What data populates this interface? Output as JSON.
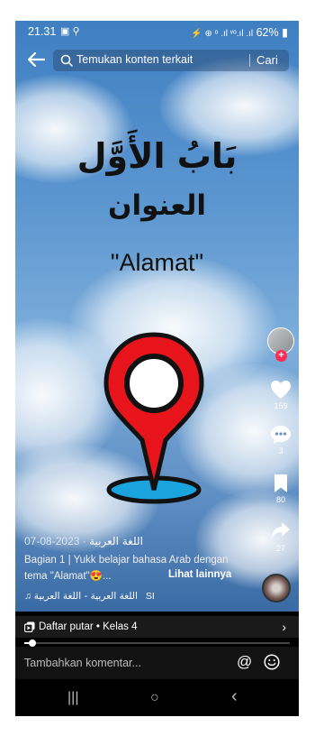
{
  "status_bar": {
    "time": "21.31",
    "indicators": "⚡ ⊕ ᵒ .ıl ᵛᵒ.ıl .ıl",
    "battery": "62%"
  },
  "search": {
    "placeholder": "Temukan konten terkait",
    "button_label": "Cari"
  },
  "video": {
    "title_arabic": "بَابُ الأَوَّل",
    "subtitle_arabic": "العنوان",
    "title_latin": "\"Alamat\""
  },
  "actions": {
    "like_count": "159",
    "comment_count": "3",
    "save_count": "80",
    "share_count": "27"
  },
  "caption": {
    "author": "اللغة العربية",
    "date": "· 2023-08-07",
    "description_line1": "Bagian 1 | Yukk belajar bahasa Arab dengan",
    "description_line2": "tema \"Alamat\"😍...",
    "see_more": "Lihat lainnya",
    "music": "اللغة العربية - اللغة العربية",
    "music_prefix": "SI"
  },
  "playlist": {
    "label": "Daftar putar • Kelas 4",
    "chevron": "›"
  },
  "progress": {
    "fraction": 0.03
  },
  "comment": {
    "placeholder": "Tambahkan komentar...",
    "mention_label": "@"
  },
  "nav": {
    "recent": "|||",
    "home": "○",
    "back": "‹"
  },
  "colors": {
    "accent_red": "#fe2c55",
    "pin_red": "#e8141c",
    "pin_base": "#1aa3dd"
  }
}
